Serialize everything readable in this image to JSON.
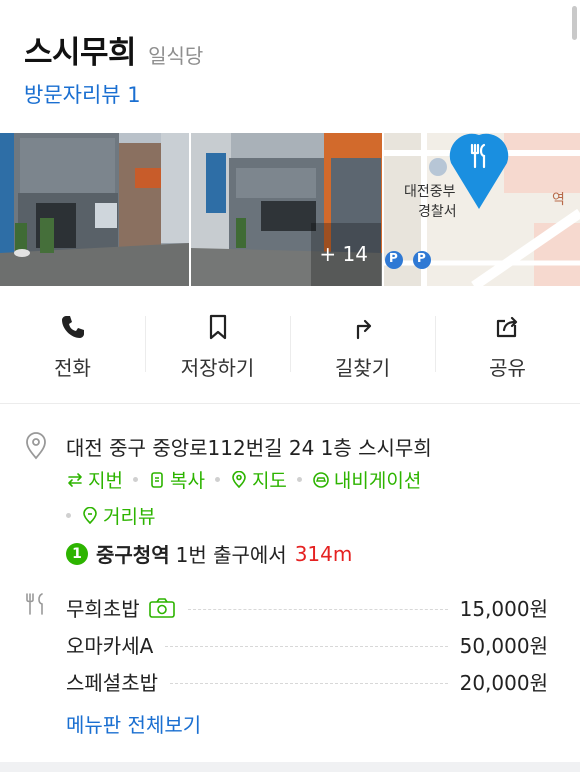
{
  "place": {
    "name": "스시무희",
    "category": "일식당",
    "review_link": "방문자리뷰 1"
  },
  "photos": {
    "more_count": "+ 14",
    "map_labels": [
      "대전중부",
      "경찰서",
      "역",
      "P",
      "P"
    ]
  },
  "actions": [
    {
      "label": "전화",
      "icon": "phone-icon"
    },
    {
      "label": "저장하기",
      "icon": "bookmark-icon"
    },
    {
      "label": "길찾기",
      "icon": "directions-icon"
    },
    {
      "label": "공유",
      "icon": "share-icon"
    }
  ],
  "info": {
    "address": "대전 중구 중앙로112번길 24 1층 스시무희",
    "links": [
      {
        "label": "지번",
        "icon": "swap-icon"
      },
      {
        "label": "복사",
        "icon": "copy-icon"
      },
      {
        "label": "지도",
        "icon": "map-pin-icon"
      },
      {
        "label": "내비게이션",
        "icon": "car-icon"
      },
      {
        "label": "거리뷰",
        "icon": "street-view-icon"
      }
    ],
    "subway": {
      "line": "1",
      "station": "중구청역",
      "exit_text": "1번 출구에서",
      "distance": "314m",
      "line_color": "#2db400"
    }
  },
  "menu": {
    "items": [
      {
        "name": "무희초밥",
        "price": "15,000원",
        "has_photo": true
      },
      {
        "name": "오마카세A",
        "price": "50,000원",
        "has_photo": false
      },
      {
        "name": "스페셜초밥",
        "price": "20,000원",
        "has_photo": false
      }
    ],
    "more_label": "메뉴판 전체보기"
  },
  "colors": {
    "link_blue": "#1a6fd1",
    "green": "#2db400",
    "distance_red": "#e52222",
    "map_pin": "#1a8fe0"
  }
}
